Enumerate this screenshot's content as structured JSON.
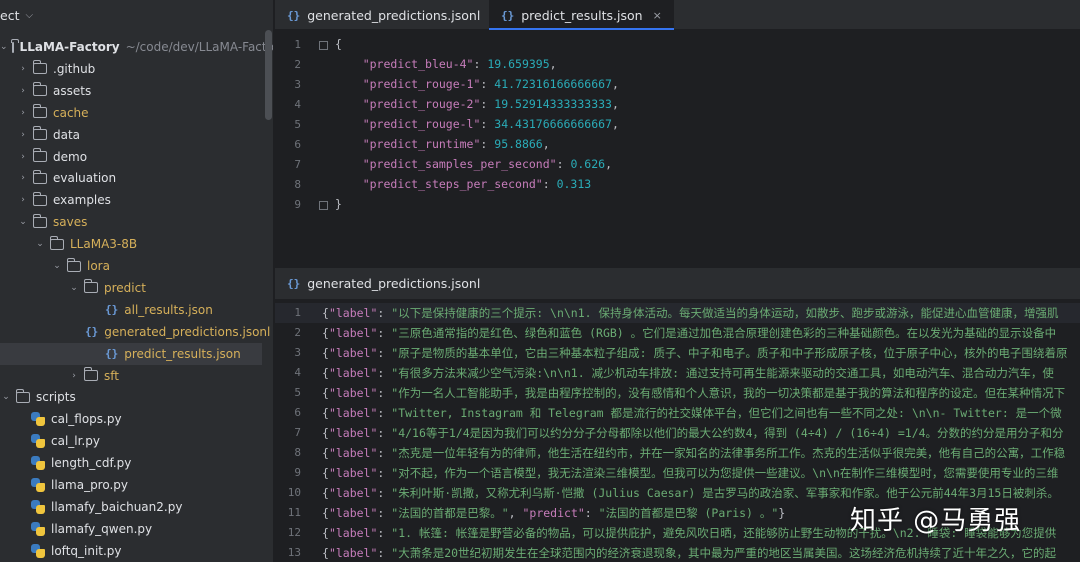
{
  "sidebar": {
    "header": "ect",
    "items": [
      {
        "label": "LLaMA-Factory",
        "path": "~/code/dev/LLaMA-Factory",
        "type": "folder",
        "open": true,
        "depth": 0,
        "style": "bold"
      },
      {
        "label": ".github",
        "type": "folder",
        "open": false,
        "depth": 1
      },
      {
        "label": "assets",
        "type": "folder",
        "open": false,
        "depth": 1
      },
      {
        "label": "cache",
        "type": "folder",
        "open": false,
        "depth": 1,
        "style": "yellow"
      },
      {
        "label": "data",
        "type": "folder",
        "open": false,
        "depth": 1
      },
      {
        "label": "demo",
        "type": "folder",
        "open": false,
        "depth": 1
      },
      {
        "label": "evaluation",
        "type": "folder",
        "open": false,
        "depth": 1
      },
      {
        "label": "examples",
        "type": "folder",
        "open": false,
        "depth": 1
      },
      {
        "label": "saves",
        "type": "folder",
        "open": true,
        "depth": 1,
        "style": "yellow"
      },
      {
        "label": "LLaMA3-8B",
        "type": "folder",
        "open": true,
        "depth": 2,
        "style": "yellow"
      },
      {
        "label": "lora",
        "type": "folder",
        "open": true,
        "depth": 3,
        "style": "yellow"
      },
      {
        "label": "predict",
        "type": "folder",
        "open": true,
        "depth": 4,
        "style": "yellow"
      },
      {
        "label": "all_results.json",
        "type": "json",
        "depth": 5,
        "style": "yellow"
      },
      {
        "label": "generated_predictions.jsonl",
        "type": "json",
        "depth": 5,
        "style": "yellow"
      },
      {
        "label": "predict_results.json",
        "type": "json",
        "depth": 5,
        "style": "yellow",
        "selected": true
      },
      {
        "label": "sft",
        "type": "folder",
        "open": false,
        "depth": 4,
        "style": "yellow"
      },
      {
        "label": "scripts",
        "type": "folder",
        "open": true,
        "depth": 0
      },
      {
        "label": "cal_flops.py",
        "type": "py",
        "depth": 1
      },
      {
        "label": "cal_lr.py",
        "type": "py",
        "depth": 1
      },
      {
        "label": "length_cdf.py",
        "type": "py",
        "depth": 1
      },
      {
        "label": "llama_pro.py",
        "type": "py",
        "depth": 1
      },
      {
        "label": "llamafy_baichuan2.py",
        "type": "py",
        "depth": 1
      },
      {
        "label": "llamafy_qwen.py",
        "type": "py",
        "depth": 1
      },
      {
        "label": "loftq_init.py",
        "type": "py",
        "depth": 1
      }
    ]
  },
  "tabs_top": [
    {
      "label": "generated_predictions.jsonl",
      "active": false
    },
    {
      "label": "predict_results.json",
      "active": true,
      "close": "×"
    }
  ],
  "top_editor": {
    "line_numbers": [
      "1",
      "2",
      "3",
      "4",
      "5",
      "6",
      "7",
      "8",
      "9"
    ],
    "lines": [
      [
        {
          "t": "{",
          "c": "p"
        }
      ],
      [
        {
          "t": "    ",
          "c": "p"
        },
        {
          "t": "\"predict_bleu-4\"",
          "c": "k"
        },
        {
          "t": ": ",
          "c": "p"
        },
        {
          "t": "19.659395",
          "c": "n"
        },
        {
          "t": ",",
          "c": "p"
        }
      ],
      [
        {
          "t": "    ",
          "c": "p"
        },
        {
          "t": "\"predict_rouge-1\"",
          "c": "k"
        },
        {
          "t": ": ",
          "c": "p"
        },
        {
          "t": "41.72316166666667",
          "c": "n"
        },
        {
          "t": ",",
          "c": "p"
        }
      ],
      [
        {
          "t": "    ",
          "c": "p"
        },
        {
          "t": "\"predict_rouge-2\"",
          "c": "k"
        },
        {
          "t": ": ",
          "c": "p"
        },
        {
          "t": "19.52914333333333",
          "c": "n"
        },
        {
          "t": ",",
          "c": "p"
        }
      ],
      [
        {
          "t": "    ",
          "c": "p"
        },
        {
          "t": "\"predict_rouge-l\"",
          "c": "k"
        },
        {
          "t": ": ",
          "c": "p"
        },
        {
          "t": "34.43176666666667",
          "c": "n"
        },
        {
          "t": ",",
          "c": "p"
        }
      ],
      [
        {
          "t": "    ",
          "c": "p"
        },
        {
          "t": "\"predict_runtime\"",
          "c": "k"
        },
        {
          "t": ": ",
          "c": "p"
        },
        {
          "t": "95.8866",
          "c": "n"
        },
        {
          "t": ",",
          "c": "p"
        }
      ],
      [
        {
          "t": "    ",
          "c": "p"
        },
        {
          "t": "\"predict_samples_per_second\"",
          "c": "k"
        },
        {
          "t": ": ",
          "c": "p"
        },
        {
          "t": "0.626",
          "c": "n"
        },
        {
          "t": ",",
          "c": "p"
        }
      ],
      [
        {
          "t": "    ",
          "c": "p"
        },
        {
          "t": "\"predict_steps_per_second\"",
          "c": "k"
        },
        {
          "t": ": ",
          "c": "p"
        },
        {
          "t": "0.313",
          "c": "n"
        }
      ],
      [
        {
          "t": "}",
          "c": "p"
        }
      ]
    ]
  },
  "bottom_tab": {
    "label": "generated_predictions.jsonl"
  },
  "bottom_editor": {
    "line_numbers": [
      "1",
      "2",
      "3",
      "4",
      "5",
      "6",
      "7",
      "8",
      "9",
      "10",
      "11",
      "12",
      "13"
    ],
    "lines": [
      [
        {
          "t": "{",
          "c": "p"
        },
        {
          "t": "\"label\"",
          "c": "k"
        },
        {
          "t": ": ",
          "c": "p"
        },
        {
          "t": "\"以下是保持健康的三个提示: \\n\\n1. 保持身体活动。每天做适当的身体运动，如散步、跑步或游泳，能促进心血管健康，增强肌",
          "c": "s"
        }
      ],
      [
        {
          "t": "{",
          "c": "p"
        },
        {
          "t": "\"label\"",
          "c": "k"
        },
        {
          "t": ": ",
          "c": "p"
        },
        {
          "t": "\"三原色通常指的是红色、绿色和蓝色 (RGB) 。它们是通过加色混合原理创建色彩的三种基础颜色。在以发光为基础的显示设备中",
          "c": "s"
        }
      ],
      [
        {
          "t": "{",
          "c": "p"
        },
        {
          "t": "\"label\"",
          "c": "k"
        },
        {
          "t": ": ",
          "c": "p"
        },
        {
          "t": "\"原子是物质的基本单位，它由三种基本粒子组成: 质子、中子和电子。质子和中子形成原子核，位于原子中心，核外的电子围绕着原",
          "c": "s"
        }
      ],
      [
        {
          "t": "{",
          "c": "p"
        },
        {
          "t": "\"label\"",
          "c": "k"
        },
        {
          "t": ": ",
          "c": "p"
        },
        {
          "t": "\"有很多方法来减少空气污染:\\n\\n1. 减少机动车排放: 通过支持可再生能源来驱动的交通工具，如电动汽车、混合动力汽车，使",
          "c": "s"
        }
      ],
      [
        {
          "t": "{",
          "c": "p"
        },
        {
          "t": "\"label\"",
          "c": "k"
        },
        {
          "t": ": ",
          "c": "p"
        },
        {
          "t": "\"作为一名人工智能助手，我是由程序控制的，没有感情和个人意识，我的一切决策都是基于我的算法和程序的设定。但在某种情况下",
          "c": "s"
        }
      ],
      [
        {
          "t": "{",
          "c": "p"
        },
        {
          "t": "\"label\"",
          "c": "k"
        },
        {
          "t": ": ",
          "c": "p"
        },
        {
          "t": "\"Twitter, Instagram 和 Telegram 都是流行的社交媒体平台，但它们之间也有一些不同之处: \\n\\n- Twitter: 是一个微",
          "c": "s"
        }
      ],
      [
        {
          "t": "{",
          "c": "p"
        },
        {
          "t": "\"label\"",
          "c": "k"
        },
        {
          "t": ": ",
          "c": "p"
        },
        {
          "t": "\"4/16等于1/4是因为我们可以约分分子分母都除以他们的最大公约数4，得到 (4÷4) / (16÷4) =1/4。分数的约分是用分子和分",
          "c": "s"
        }
      ],
      [
        {
          "t": "{",
          "c": "p"
        },
        {
          "t": "\"label\"",
          "c": "k"
        },
        {
          "t": ": ",
          "c": "p"
        },
        {
          "t": "\"杰克是一位年轻有为的律师，他生活在纽约市，并在一家知名的法律事务所工作。杰克的生活似乎很完美，他有自己的公寓，工作稳",
          "c": "s"
        }
      ],
      [
        {
          "t": "{",
          "c": "p"
        },
        {
          "t": "\"label\"",
          "c": "k"
        },
        {
          "t": ": ",
          "c": "p"
        },
        {
          "t": "\"对不起，作为一个语言模型，我无法渲染三维模型。但我可以为您提供一些建议。\\n\\n在制作三维模型时，您需要使用专业的三维",
          "c": "s"
        }
      ],
      [
        {
          "t": "{",
          "c": "p"
        },
        {
          "t": "\"label\"",
          "c": "k"
        },
        {
          "t": ": ",
          "c": "p"
        },
        {
          "t": "\"朱利叶斯·凯撒，又称尤利乌斯·恺撒 (Julius Caesar) 是古罗马的政治家、军事家和作家。他于公元前44年3月15日被刺杀。",
          "c": "s"
        }
      ],
      [
        {
          "t": "{",
          "c": "p"
        },
        {
          "t": "\"label\"",
          "c": "k"
        },
        {
          "t": ": ",
          "c": "p"
        },
        {
          "t": "\"法国的首都是巴黎。\"",
          "c": "s"
        },
        {
          "t": ", ",
          "c": "p"
        },
        {
          "t": "\"predict\"",
          "c": "k"
        },
        {
          "t": ": ",
          "c": "p"
        },
        {
          "t": "\"法国的首都是巴黎 (Paris) 。\"",
          "c": "s"
        },
        {
          "t": "}",
          "c": "p"
        }
      ],
      [
        {
          "t": "{",
          "c": "p"
        },
        {
          "t": "\"label\"",
          "c": "k"
        },
        {
          "t": ": ",
          "c": "p"
        },
        {
          "t": "\"1. 帐篷: 帐篷是野营必备的物品，可以提供庇护，避免风吹日晒，还能够防止野生动物的干扰。\\n2. 睡袋: 睡袋能够为您提供",
          "c": "s"
        }
      ],
      [
        {
          "t": "{",
          "c": "p"
        },
        {
          "t": "\"label\"",
          "c": "k"
        },
        {
          "t": ": ",
          "c": "p"
        },
        {
          "t": "\"大萧条是20世纪初期发生在全球范围内的经济衰退现象，其中最为严重的地区当属美国。这场经济危机持续了近十年之久，它的起",
          "c": "s"
        }
      ]
    ]
  },
  "watermark": "知乎 @马勇强"
}
